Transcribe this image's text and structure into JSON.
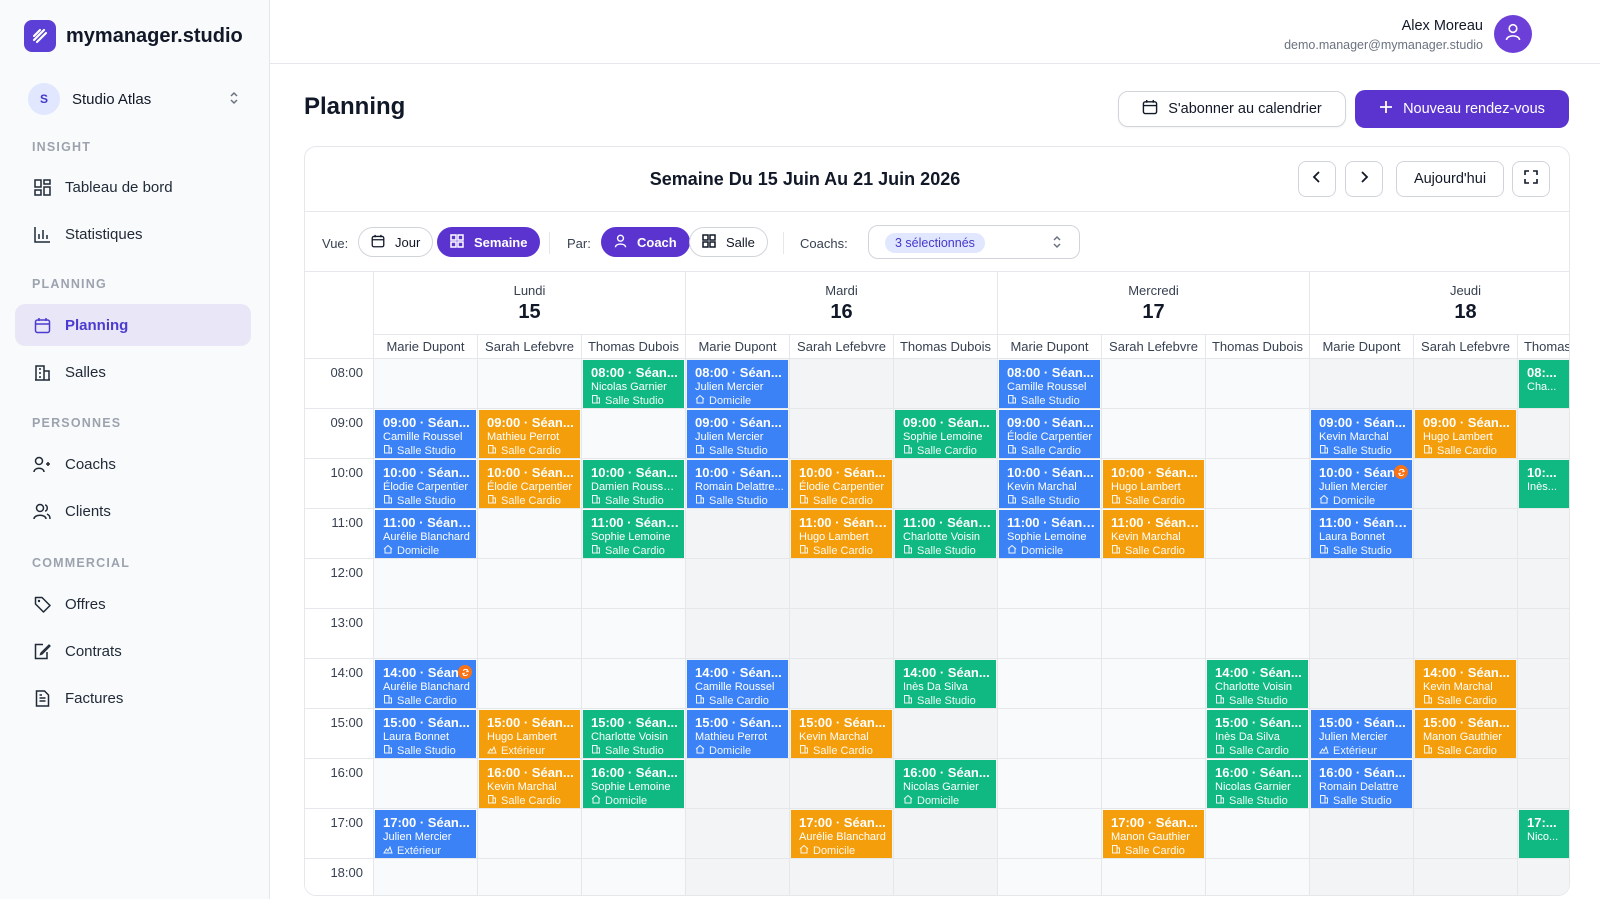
{
  "app": {
    "name": "mymanager.studio",
    "workspace_initial": "S",
    "workspace_name": "Studio Atlas"
  },
  "colors": {
    "accent": "#5b34d0",
    "blue": "#3b82f6",
    "orange": "#f59e0b",
    "green": "#10b981"
  },
  "nav": {
    "insight": "INSIGHT",
    "planning_section": "PLANNING",
    "personnes": "PERSONNES",
    "commercial": "COMMERCIAL",
    "items": [
      {
        "label": "Tableau de bord",
        "icon": "dashboard-icon"
      },
      {
        "label": "Statistiques",
        "icon": "chart-icon"
      },
      {
        "label": "Planning",
        "icon": "calendar-icon",
        "active": true
      },
      {
        "label": "Salles",
        "icon": "building-icon"
      },
      {
        "label": "Coachs",
        "icon": "coach-icon"
      },
      {
        "label": "Clients",
        "icon": "users-icon"
      },
      {
        "label": "Offres",
        "icon": "tag-icon"
      },
      {
        "label": "Contrats",
        "icon": "contract-icon"
      },
      {
        "label": "Factures",
        "icon": "invoice-icon"
      }
    ]
  },
  "user": {
    "name": "Alex Moreau",
    "email": "demo.manager@mymanager.studio"
  },
  "page": {
    "title": "Planning",
    "subscribe": "S'abonner au calendrier",
    "new_appt": "Nouveau rendez-vous"
  },
  "calendar": {
    "week_title": "Semaine Du 15 Juin Au 21 Juin 2026",
    "today": "Aujourd'hui",
    "vue_label": "Vue:",
    "jour": "Jour",
    "semaine": "Semaine",
    "par_label": "Par:",
    "coach": "Coach",
    "salle": "Salle",
    "coachs_label": "Coachs:",
    "coachs_selected": "3 sélectionnés",
    "days": [
      {
        "name": "Lundi",
        "num": "15"
      },
      {
        "name": "Mardi",
        "num": "16"
      },
      {
        "name": "Mercredi",
        "num": "17"
      },
      {
        "name": "Jeudi",
        "num": "18"
      }
    ],
    "coaches": [
      "Marie Dupont",
      "Sarah Lefebvre",
      "Thomas Dubois"
    ],
    "times": [
      "08:00",
      "09:00",
      "10:00",
      "11:00",
      "12:00",
      "13:00",
      "14:00",
      "15:00",
      "16:00",
      "17:00",
      "18:00"
    ],
    "events": [
      {
        "col": 0,
        "slot": 1,
        "title": "09:00 · Séan...",
        "client": "Camille Roussel",
        "room": "Salle Studio",
        "color": "blue"
      },
      {
        "col": 0,
        "slot": 2,
        "title": "10:00 · Séan...",
        "client": "Élodie Carpentier",
        "room": "Salle Studio",
        "color": "blue"
      },
      {
        "col": 0,
        "slot": 3,
        "title": "11:00 · Séanc...",
        "client": "Aurélie Blanchard",
        "room": "Domicile",
        "color": "blue"
      },
      {
        "col": 0,
        "slot": 6,
        "title": "14:00 · Séan",
        "client": "Aurélie Blanchard",
        "room": "Salle Cardio",
        "color": "blue",
        "sync": true
      },
      {
        "col": 0,
        "slot": 7,
        "title": "15:00 · Séan...",
        "client": "Laura Bonnet",
        "room": "Salle Studio",
        "color": "blue"
      },
      {
        "col": 0,
        "slot": 9,
        "title": "17:00 · Séan...",
        "client": "Julien Mercier",
        "room": "Extérieur",
        "color": "blue"
      },
      {
        "col": 1,
        "slot": 1,
        "title": "09:00 · Séan...",
        "client": "Mathieu Perrot",
        "room": "Salle Cardio",
        "color": "orange"
      },
      {
        "col": 1,
        "slot": 2,
        "title": "10:00 · Séan...",
        "client": "Élodie Carpentier",
        "room": "Salle Cardio",
        "color": "orange"
      },
      {
        "col": 1,
        "slot": 7,
        "title": "15:00 · Séan...",
        "client": "Hugo Lambert",
        "room": "Extérieur",
        "color": "orange"
      },
      {
        "col": 1,
        "slot": 8,
        "title": "16:00 · Séan...",
        "client": "Kevin Marchal",
        "room": "Salle Cardio",
        "color": "orange"
      },
      {
        "col": 2,
        "slot": 0,
        "title": "08:00 · Séan...",
        "client": "Nicolas Garnier",
        "room": "Salle Studio",
        "color": "green"
      },
      {
        "col": 2,
        "slot": 2,
        "title": "10:00 · Séan...",
        "client": "Damien Rousseau",
        "room": "Salle Studio",
        "color": "green"
      },
      {
        "col": 2,
        "slot": 3,
        "title": "11:00 · Séanc...",
        "client": "Sophie Lemoine",
        "room": "Salle Cardio",
        "color": "green"
      },
      {
        "col": 2,
        "slot": 7,
        "title": "15:00 · Séan...",
        "client": "Charlotte Voisin",
        "room": "Salle Studio",
        "color": "green"
      },
      {
        "col": 2,
        "slot": 8,
        "title": "16:00 · Séan...",
        "client": "Sophie Lemoine",
        "room": "Domicile",
        "color": "green"
      },
      {
        "col": 3,
        "slot": 0,
        "title": "08:00 · Séan...",
        "client": "Julien Mercier",
        "room": "Domicile",
        "color": "blue"
      },
      {
        "col": 3,
        "slot": 1,
        "title": "09:00 · Séan...",
        "client": "Julien Mercier",
        "room": "Salle Studio",
        "color": "blue"
      },
      {
        "col": 3,
        "slot": 2,
        "title": "10:00 · Séan...",
        "client": "Romain Delattre...",
        "room": "Salle Studio",
        "color": "blue"
      },
      {
        "col": 3,
        "slot": 6,
        "title": "14:00 · Séan...",
        "client": "Camille Roussel",
        "room": "Salle Cardio",
        "color": "blue"
      },
      {
        "col": 3,
        "slot": 7,
        "title": "15:00 · Séan...",
        "client": "Mathieu Perrot",
        "room": "Domicile",
        "color": "blue"
      },
      {
        "col": 4,
        "slot": 2,
        "title": "10:00 · Séan...",
        "client": "Élodie Carpentier",
        "room": "Salle Cardio",
        "color": "orange"
      },
      {
        "col": 4,
        "slot": 3,
        "title": "11:00 · Séanc...",
        "client": "Hugo Lambert",
        "room": "Salle Cardio",
        "color": "orange"
      },
      {
        "col": 4,
        "slot": 7,
        "title": "15:00 · Séan...",
        "client": "Kevin Marchal",
        "room": "Salle Cardio",
        "color": "orange"
      },
      {
        "col": 4,
        "slot": 9,
        "title": "17:00 · Séan...",
        "client": "Aurélie Blanchard",
        "room": "Domicile",
        "color": "orange"
      },
      {
        "col": 5,
        "slot": 1,
        "title": "09:00 · Séan...",
        "client": "Sophie Lemoine",
        "room": "Salle Cardio",
        "color": "green"
      },
      {
        "col": 5,
        "slot": 3,
        "title": "11:00 · Séanc...",
        "client": "Charlotte Voisin",
        "room": "Salle Studio",
        "color": "green"
      },
      {
        "col": 5,
        "slot": 6,
        "title": "14:00 · Séan...",
        "client": "Inès Da Silva",
        "room": "Salle Studio",
        "color": "green"
      },
      {
        "col": 5,
        "slot": 8,
        "title": "16:00 · Séan...",
        "client": "Nicolas Garnier",
        "room": "Domicile",
        "color": "green"
      },
      {
        "col": 6,
        "slot": 0,
        "title": "08:00 · Séan...",
        "client": "Camille Roussel",
        "room": "Salle Studio",
        "color": "blue"
      },
      {
        "col": 6,
        "slot": 1,
        "title": "09:00 · Séan...",
        "client": "Élodie Carpentier",
        "room": "Salle Cardio",
        "color": "blue"
      },
      {
        "col": 6,
        "slot": 2,
        "title": "10:00 · Séan...",
        "client": "Kevin Marchal",
        "room": "Salle Studio",
        "color": "blue"
      },
      {
        "col": 6,
        "slot": 3,
        "title": "11:00 · Séanc...",
        "client": "Sophie Lemoine",
        "room": "Domicile",
        "color": "blue"
      },
      {
        "col": 7,
        "slot": 2,
        "title": "10:00 · Séan...",
        "client": "Hugo Lambert",
        "room": "Salle Cardio",
        "color": "orange"
      },
      {
        "col": 7,
        "slot": 3,
        "title": "11:00 · Séanc...",
        "client": "Kevin Marchal",
        "room": "Salle Cardio",
        "color": "orange"
      },
      {
        "col": 7,
        "slot": 9,
        "title": "17:00 · Séan...",
        "client": "Manon Gauthier",
        "room": "Salle Cardio",
        "color": "orange"
      },
      {
        "col": 8,
        "slot": 6,
        "title": "14:00 · Séan...",
        "client": "Charlotte Voisin",
        "room": "Salle Studio",
        "color": "green"
      },
      {
        "col": 8,
        "slot": 7,
        "title": "15:00 · Séan...",
        "client": "Inès Da Silva",
        "room": "Salle Cardio",
        "color": "green"
      },
      {
        "col": 8,
        "slot": 8,
        "title": "16:00 · Séan...",
        "client": "Nicolas Garnier",
        "room": "Salle Studio",
        "color": "green"
      },
      {
        "col": 9,
        "slot": 1,
        "title": "09:00 · Séan...",
        "client": "Kevin Marchal",
        "room": "Salle Studio",
        "color": "blue"
      },
      {
        "col": 9,
        "slot": 2,
        "title": "10:00 · Séan",
        "client": "Julien Mercier",
        "room": "Domicile",
        "color": "blue",
        "sync": true
      },
      {
        "col": 9,
        "slot": 3,
        "title": "11:00 · Séanc...",
        "client": "Laura Bonnet",
        "room": "Salle Studio",
        "color": "blue"
      },
      {
        "col": 9,
        "slot": 7,
        "title": "15:00 · Séan...",
        "client": "Julien Mercier",
        "room": "Extérieur",
        "color": "blue"
      },
      {
        "col": 9,
        "slot": 8,
        "title": "16:00 · Séan...",
        "client": "Romain Delattre",
        "room": "Salle Studio",
        "color": "blue"
      },
      {
        "col": 10,
        "slot": 1,
        "title": "09:00 · Séan...",
        "client": "Hugo Lambert",
        "room": "Salle Cardio",
        "color": "orange"
      },
      {
        "col": 10,
        "slot": 6,
        "title": "14:00 · Séan...",
        "client": "Kevin Marchal",
        "room": "Salle Cardio",
        "color": "orange"
      },
      {
        "col": 10,
        "slot": 7,
        "title": "15:00 · Séan...",
        "client": "Manon Gauthier",
        "room": "Salle Cardio",
        "color": "orange"
      },
      {
        "col": 11,
        "slot": 0,
        "title": "08:...",
        "client": "Cha...",
        "room": "",
        "color": "green"
      },
      {
        "col": 11,
        "slot": 2,
        "title": "10:...",
        "client": "Inès...",
        "room": "",
        "color": "green"
      },
      {
        "col": 11,
        "slot": 9,
        "title": "17:...",
        "client": "Nico...",
        "room": "",
        "color": "green"
      }
    ]
  }
}
